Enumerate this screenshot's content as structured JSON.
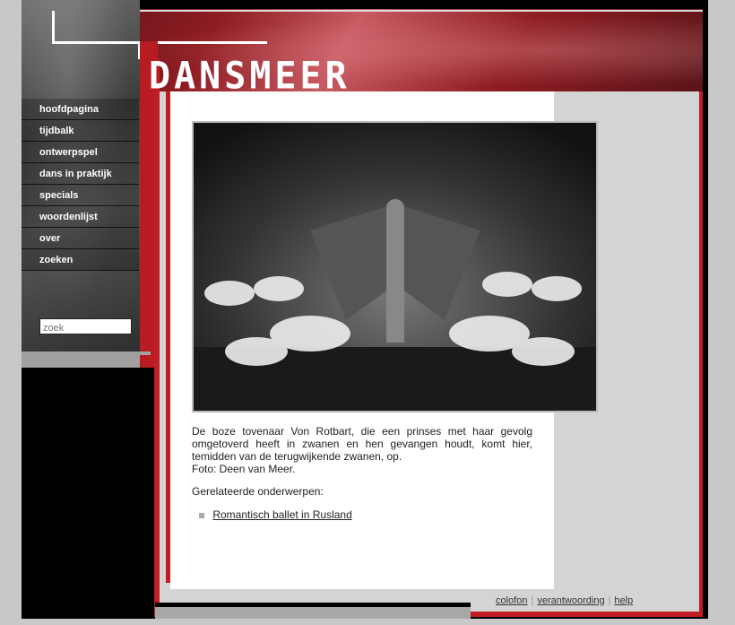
{
  "site": {
    "logo_text": "DANSMEER"
  },
  "nav": {
    "items": [
      {
        "label": "hoofdpagina"
      },
      {
        "label": "tijdbalk"
      },
      {
        "label": "ontwerpspel"
      },
      {
        "label": "dans in praktijk"
      },
      {
        "label": "specials"
      },
      {
        "label": "woordenlijst"
      },
      {
        "label": "over"
      },
      {
        "label": "zoeken"
      }
    ]
  },
  "search": {
    "placeholder": "zoek"
  },
  "main": {
    "caption": "De boze tovenaar Von Rotbart, die een prinses met haar gevolg omgetoverd heeft in zwanen en hen gevangen houdt, komt hier, temidden van de terugwijkende zwanen, op.",
    "photo_credit": "Foto: Deen van Meer.",
    "related_heading": "Gerelateerde onderwerpen:",
    "related_items": [
      {
        "label": "Romantisch ballet in Rusland"
      }
    ]
  },
  "footer": {
    "links": [
      {
        "label": "colofon"
      },
      {
        "label": "verantwoording"
      },
      {
        "label": "help"
      }
    ]
  },
  "colors": {
    "brand_red": "#c01e24",
    "dark_red": "#8e1c22",
    "panel_gray": "#d4d4d4"
  }
}
